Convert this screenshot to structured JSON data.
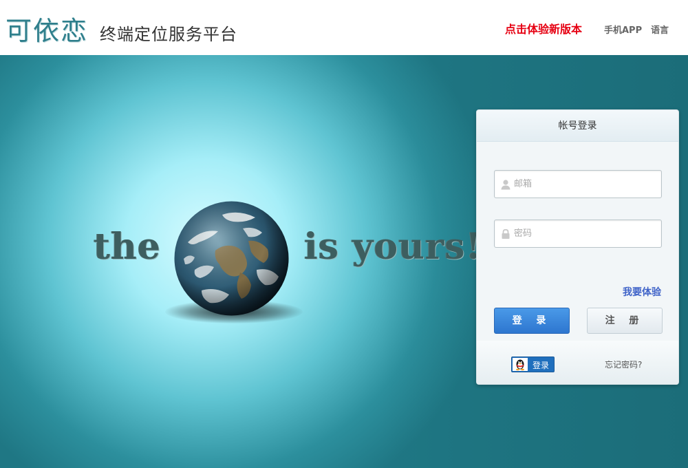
{
  "header": {
    "logo": "可依恋",
    "subtitle": "终端定位服务平台",
    "nav": {
      "new_version": "点击体验新版本",
      "mobile_app": "手机APP",
      "language": "语言"
    }
  },
  "hero": {
    "slogan_left": "the",
    "slogan_right": "is yours!"
  },
  "login": {
    "title": "帐号登录",
    "email_placeholder": "邮箱",
    "password_placeholder": "密码",
    "try_link": "我要体验",
    "login_button": "登 录",
    "register_button": "注 册",
    "qq_login": "登录",
    "forgot_password": "忘记密码?"
  },
  "colors": {
    "brand": "#2f7f8c",
    "accent_red": "#e60012",
    "link_blue": "#3f63c8",
    "login_button": "#2d76cf"
  },
  "icons": [
    "user-icon",
    "lock-icon",
    "qq-penguin-icon",
    "globe-image"
  ]
}
